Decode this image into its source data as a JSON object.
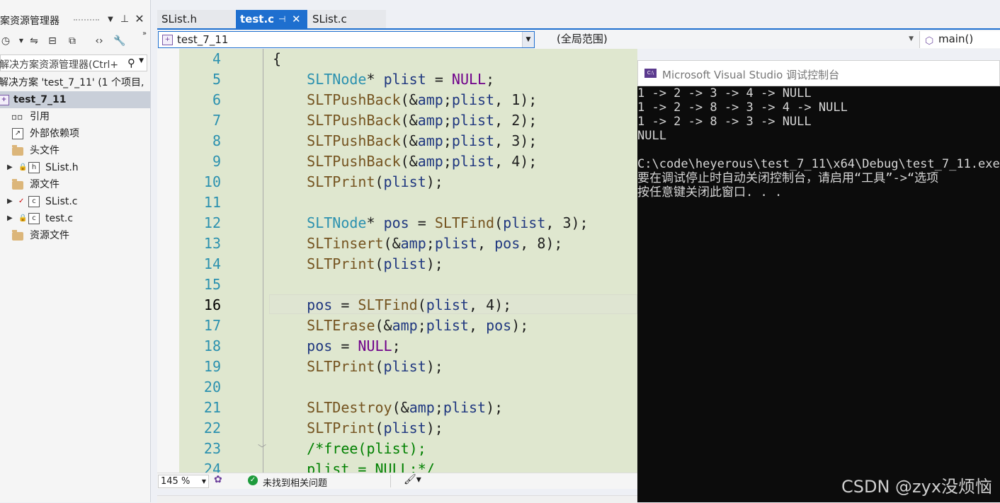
{
  "solution_explorer": {
    "title": "案资源管理器",
    "search_placeholder": "解决方案资源管理器(Ctrl+",
    "tree": [
      {
        "label": "解决方案 'test_7_11' (1 个项目,"
      },
      {
        "label": "test_7_11"
      },
      {
        "label": "引用"
      },
      {
        "label": "外部依赖项"
      },
      {
        "label": "头文件"
      },
      {
        "label": "SList.h"
      },
      {
        "label": "源文件"
      },
      {
        "label": "SList.c"
      },
      {
        "label": "test.c"
      },
      {
        "label": "资源文件"
      }
    ]
  },
  "tabs": [
    {
      "label": "SList.h",
      "active": false
    },
    {
      "label": "test.c",
      "active": true
    },
    {
      "label": "SList.c",
      "active": false
    }
  ],
  "navbar": {
    "project": "test_7_11",
    "scope": "(全局范围)",
    "function": "main()"
  },
  "editor": {
    "line_numbers": [
      "4",
      "5",
      "6",
      "7",
      "8",
      "9",
      "10",
      "11",
      "12",
      "13",
      "14",
      "15",
      "16",
      "17",
      "18",
      "19",
      "20",
      "21",
      "22",
      "23",
      "24"
    ],
    "current_line": "16",
    "lines": [
      "{",
      "    SLTNode* plist = NULL;",
      "    SLTPushBack(&plist, 1);",
      "    SLTPushBack(&plist, 2);",
      "    SLTPushBack(&plist, 3);",
      "    SLTPushBack(&plist, 4);",
      "    SLTPrint(plist);",
      "",
      "    SLTNode* pos = SLTFind(plist, 3);",
      "    SLTinsert(&plist, pos, 8);",
      "    SLTPrint(plist);",
      "",
      "    pos = SLTFind(plist, 4);",
      "    SLTErase(&plist, pos);",
      "    pos = NULL;",
      "    SLTPrint(plist);",
      "",
      "    SLTDestroy(&plist);",
      "    SLTPrint(plist);",
      "    /*free(plist);",
      "    plist = NULL;*/"
    ]
  },
  "statusbar": {
    "zoom": "145 %",
    "issues": "未找到相关问题"
  },
  "console": {
    "title": "Microsoft Visual Studio 调试控制台",
    "icon_text": "C:\\",
    "lines": [
      "1 -> 2 -> 3 -> 4 -> NULL",
      "1 -> 2 -> 8 -> 3 -> 4 -> NULL",
      "1 -> 2 -> 8 -> 3 -> NULL",
      "NULL",
      "",
      "C:\\code\\heyerous\\test_7_11\\x64\\Debug\\test_7_11.exe",
      "要在调试停止时自动关闭控制台，请启用“工具”->“选项",
      "按任意键关闭此窗口. . ."
    ]
  },
  "watermark": "CSDN @zyx没烦恼",
  "colors": {
    "accent": "#1e6fcf",
    "editor_bg": "#dfe7cf",
    "line_number": "#2b91af",
    "type": "#2b91af",
    "function": "#74531f",
    "keyword_macro": "#6f008a",
    "comment": "#008000",
    "console_bg": "#0c0c0c"
  }
}
